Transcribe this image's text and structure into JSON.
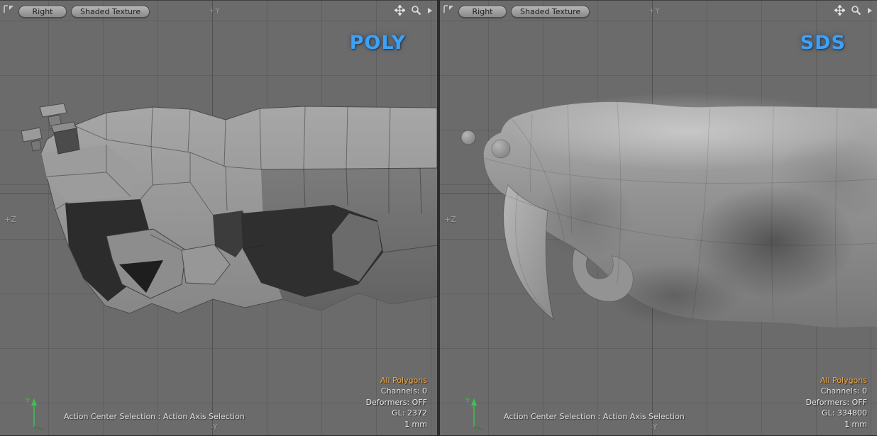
{
  "colors": {
    "mode_label": "#3da2f5",
    "selection_highlight": "#f2a73b",
    "gizmo_y_axis": "#3ec151",
    "viewport_background": "#6b6b6b"
  },
  "icons": {
    "viewport_menu": "corner-menu-icon",
    "pan": "pan-move-icon",
    "zoom": "magnifier-icon",
    "more": "right-arrow-icon"
  },
  "viewports": [
    {
      "mode_label": "POLY",
      "view_button": "Right",
      "shade_button": "Shaded Texture",
      "axis_top": "+Y",
      "axis_left": "+Z",
      "axis_bottom": "-Y",
      "gizmo_axis": "Y",
      "status": "Action Center Selection : Action Axis Selection",
      "info": {
        "selection": "All Polygons",
        "channels": "Channels: 0",
        "deformers": "Deformers: OFF",
        "gl": "GL: 2372",
        "scale": "1 mm"
      }
    },
    {
      "mode_label": "SDS",
      "view_button": "Right",
      "shade_button": "Shaded Texture",
      "axis_top": "+Y",
      "axis_left": "+Z",
      "axis_bottom": "-Y",
      "gizmo_axis": "Y",
      "status": "Action Center Selection : Action Axis Selection",
      "info": {
        "selection": "All Polygons",
        "channels": "Channels: 0",
        "deformers": "Deformers: OFF",
        "gl": "GL: 334800",
        "scale": "1 mm"
      }
    }
  ]
}
